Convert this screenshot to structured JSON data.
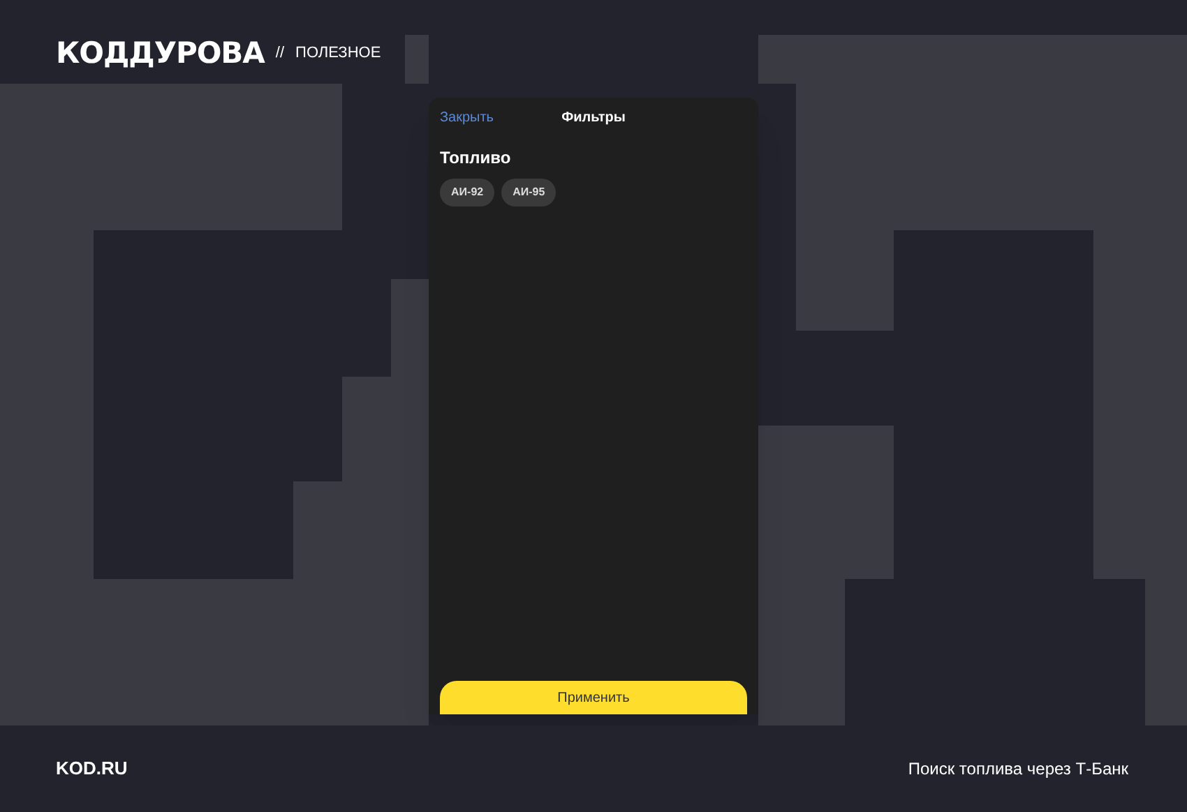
{
  "header": {
    "logo": "КОДДУРОВА",
    "separator": "//",
    "section": "ПОЛЕЗНОЕ"
  },
  "sheet": {
    "close": "Закрыть",
    "title": "Фильтры",
    "group_title": "Топливо",
    "chips": [
      {
        "label": "АИ-92",
        "selected": false
      },
      {
        "label": "АИ-95",
        "selected": false
      }
    ],
    "apply": "Применить"
  },
  "footer": {
    "site": "KOD.RU",
    "caption": "Поиск топлива через Т-Банк"
  }
}
